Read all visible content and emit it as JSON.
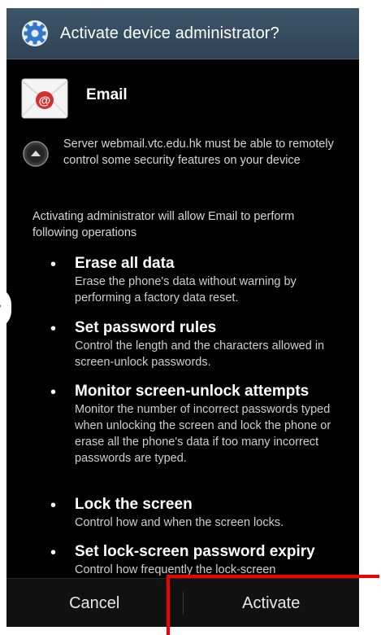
{
  "dialog": {
    "title": "Activate device administrator?",
    "app_name": "Email",
    "info_text": "Server webmail.vtc.edu.hk must be able to remotely control some security features on your device",
    "intro_text": "Activating administrator will allow Email to perform following operations",
    "permissions": [
      {
        "title": "Erase all data",
        "desc": "Erase the phone's data without warning by performing a factory data reset."
      },
      {
        "title": "Set password rules",
        "desc": "Control the length and the characters allowed in screen-unlock passwords."
      },
      {
        "title": "Monitor screen-unlock attempts",
        "desc": "Monitor the number of incorrect passwords typed when unlocking the screen and lock the phone or erase all the phone's data if too many incorrect passwords are typed."
      },
      {
        "title": "Lock the screen",
        "desc": "Control how and when the screen locks."
      },
      {
        "title": "Set lock-screen password expiry",
        "desc": "Control how frequently the lock-screen"
      }
    ],
    "cancel_label": "Cancel",
    "activate_label": "Activate"
  },
  "icons": {
    "title_icon": "gear-icon",
    "app_icon": "email-envelope-icon",
    "info_icon": "expand-up-icon",
    "side_tab_icon": "chevron-right-icon"
  },
  "colors": {
    "titlebar": "#34495d",
    "annotation": "#f00000",
    "accent": "#3a7bd5"
  }
}
